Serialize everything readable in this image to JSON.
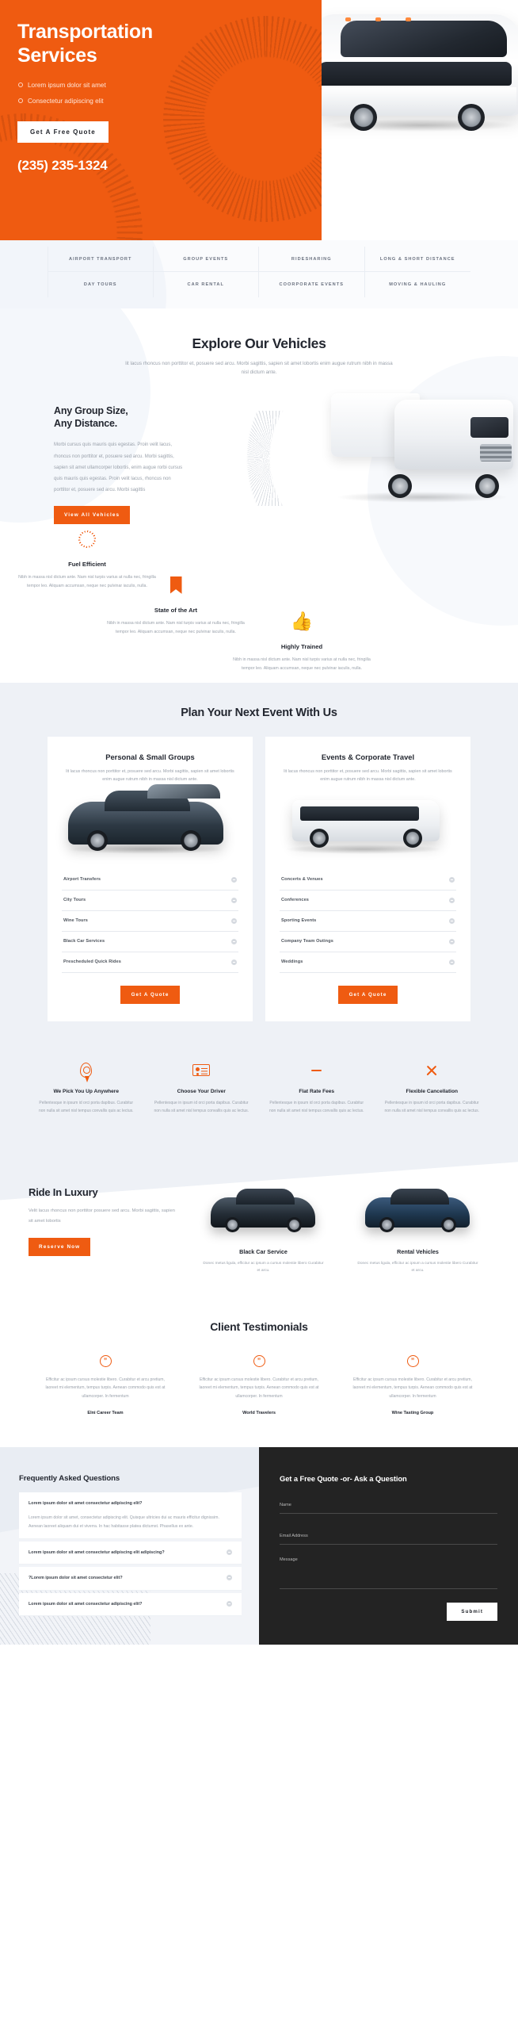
{
  "hero": {
    "title": "Transportation Services",
    "bullets": [
      "Lorem ipsum dolor sit amet",
      "Consectetur adipiscing elit"
    ],
    "cta": "Get A Free Quote",
    "phone": "(235) 235-1324"
  },
  "services_grid": [
    "AIRPORT TRANSPORT",
    "GROUP EVENTS",
    "RIDESHARING",
    "LONG & SHORT DISTANCE",
    "DAY TOURS",
    "CAR RENTAL",
    "COORPORATE EVENTS",
    "MOVING & HAULING"
  ],
  "explore": {
    "title": "Explore Our Vehicles",
    "subtitle": "lit lacus rhoncus non porttitor et, posuere sed arcu. Morbi sagittis, sapien sit amet lobortis enim augue rutrum nibh in massa nisl dictum ante.",
    "heading_line1": "Any Group Size,",
    "heading_line2": "Any Distance.",
    "body": "Morbi cursus quis mauris quis egestas. Proin velit lacus, rhoncus non porttitor et, posuere sed arcu. Morbi sagittis, sapien sit amet ullamcorper lobortis, enim augue rorbi cursus quis mauris quis egestas. Proin velit lacus, rhoncus non porttitor et, posuere sed arcu. Morbi sagittis",
    "cta": "View All Vehicles"
  },
  "features": [
    {
      "icon": "dotted-ring-icon",
      "title": "Fuel Efficient",
      "text": "Nibh in massa nisl dictum ante. Nam nisl turpis varius at nulla nec, fringilla tempor leo. Aliquam accumsan, neque nec pulvinar iaculis, nulla."
    },
    {
      "icon": "bookmark-icon",
      "title": "State of the Art",
      "text": "Nibh in massa nisl dictum ante. Nam nisl turpis varius at nulla nec, fringilla tempor leo. Aliquam accumsan, neque nec pulvinar iaculis, nulla."
    },
    {
      "icon": "thumbs-up-icon",
      "title": "Highly Trained",
      "text": "Nibh in massa nisl dictum ante. Nam nisl turpis varius at nulla nec, fringilla tempor leo. Aliquam accumsan, neque nec pulvinar iaculis, nulla."
    }
  ],
  "plan": {
    "title": "Plan Your Next Event With Us",
    "cards": [
      {
        "title": "Personal & Small Groups",
        "lead": "lit lacus rhoncus non porttitor et, posuere sed arcu. Morbi sagittis, sapien sit amet lobortis enim augue rutrum nibh in massa nisl dictum ante.",
        "items": [
          "Airport Transfers",
          "City Tours",
          "Wine Tours",
          "Black Car Services",
          "Prescheduled Quick Rides"
        ],
        "cta": "Get A Quote"
      },
      {
        "title": "Events & Corporate Travel",
        "lead": "lit lacus rhoncus non porttitor et, posuere sed arcu. Morbi sagittis, sapien sit amet lobortis enim augue rutrum nibh in massa nisl dictum ante.",
        "items": [
          "Concerts & Venues",
          "Conferences",
          "Sporting Events",
          "Company Team Outings",
          "Weddings"
        ],
        "cta": "Get A Quote"
      }
    ]
  },
  "perks": [
    {
      "icon": "map-pin-icon",
      "title": "We Pick You Up Anywhere",
      "text": "Pellentesque in ipsum id orci porta dapibus. Curabitur non nulla sit amet nisl tempus convallis quis ac lectus."
    },
    {
      "icon": "id-card-icon",
      "title": "Choose Your Driver",
      "text": "Pellentesque in ipsum id orci porta dapibus. Curabitur non nulla sit amet nisl tempus convallis quis ac lectus."
    },
    {
      "icon": "minus-icon",
      "title": "Flat Rate Fees",
      "text": "Pellentesque in ipsum id orci porta dapibus. Curabitur non nulla sit amet nisl tempus convallis quis ac lectus."
    },
    {
      "icon": "close-x-icon",
      "title": "Flexible Cancellation",
      "text": "Pellentesque in ipsum id orci porta dapibus. Curabitur non nulla sit amet nisl tempus convallis quis ac lectus."
    }
  ],
  "luxury": {
    "title": "Ride In Luxury",
    "body": "Velit lacus rhoncus non porttitor posuere sed arcu. Morbi sagittis, sapien sit amet lobortis",
    "cta": "Reserve Now",
    "cards": [
      {
        "title": "Black Car Service",
        "text": "Donec metus ligula, efficitur ac ipsum a cursus molestie libero Curabitur et arcu."
      },
      {
        "title": "Rental Vehicles",
        "text": "Donec metus ligula, efficitur ac ipsum a cursus molestie libero Curabitur et arcu."
      }
    ]
  },
  "testimonials": {
    "title": "Client Testimonials",
    "quote_glyph": "”",
    "items": [
      {
        "text": "Efficitur ac ipsum cursus molestie libero. Curabitur et arcu pretium, laoreet mi elementum, tempus turpis. Aenean commodo quis est at ullamcorper. In fermentum",
        "author": "Elni Career Team"
      },
      {
        "text": "Efficitur ac ipsum cursus molestie libero. Curabitur et arcu pretium, laoreet mi elementum, tempus turpis. Aenean commodo quis est at ullamcorper. In fermentum",
        "author": "World Travelers"
      },
      {
        "text": "Efficitur ac ipsum cursus molestie libero. Curabitur et arcu pretium, laoreet mi elementum, tempus turpis. Aenean commodo quis est at ullamcorper. In fermentum",
        "author": "Wine Tasting Group"
      }
    ]
  },
  "faq": {
    "title": "Frequently Asked Questions",
    "items": [
      {
        "question": "Lorem ipsum dolor sit amet consectetur adipiscing elit?",
        "answer": "Lorem ipsum dolor sit amet, consectetur adipiscing elit. Quisque ultricies dui ac mauris efficitur dignissim. Aenean laoreet aliquam dui et viverra. In hac habitasse platea dictumst. Phasellus ex ante.",
        "open": true
      },
      {
        "question": "Lorem ipsum dolor sit amet consectetur adipiscing elit adipiscing?",
        "answer": "",
        "open": false
      },
      {
        "question": "?Lorem ipsum dolor sit amet consectetur elit?",
        "answer": "",
        "open": false
      },
      {
        "question": "Lorem ipsum dolor sit amet consectetur adipiscing elit?",
        "answer": "",
        "open": false
      }
    ]
  },
  "contact": {
    "title": "Get a Free Quote -or- Ask a Question",
    "name_placeholder": "Name",
    "email_placeholder": "Email Address",
    "message_placeholder": "Message",
    "submit": "Submit"
  },
  "colors": {
    "accent": "#ef5b11",
    "dark": "#232323",
    "light_bg": "#eef1f6"
  }
}
